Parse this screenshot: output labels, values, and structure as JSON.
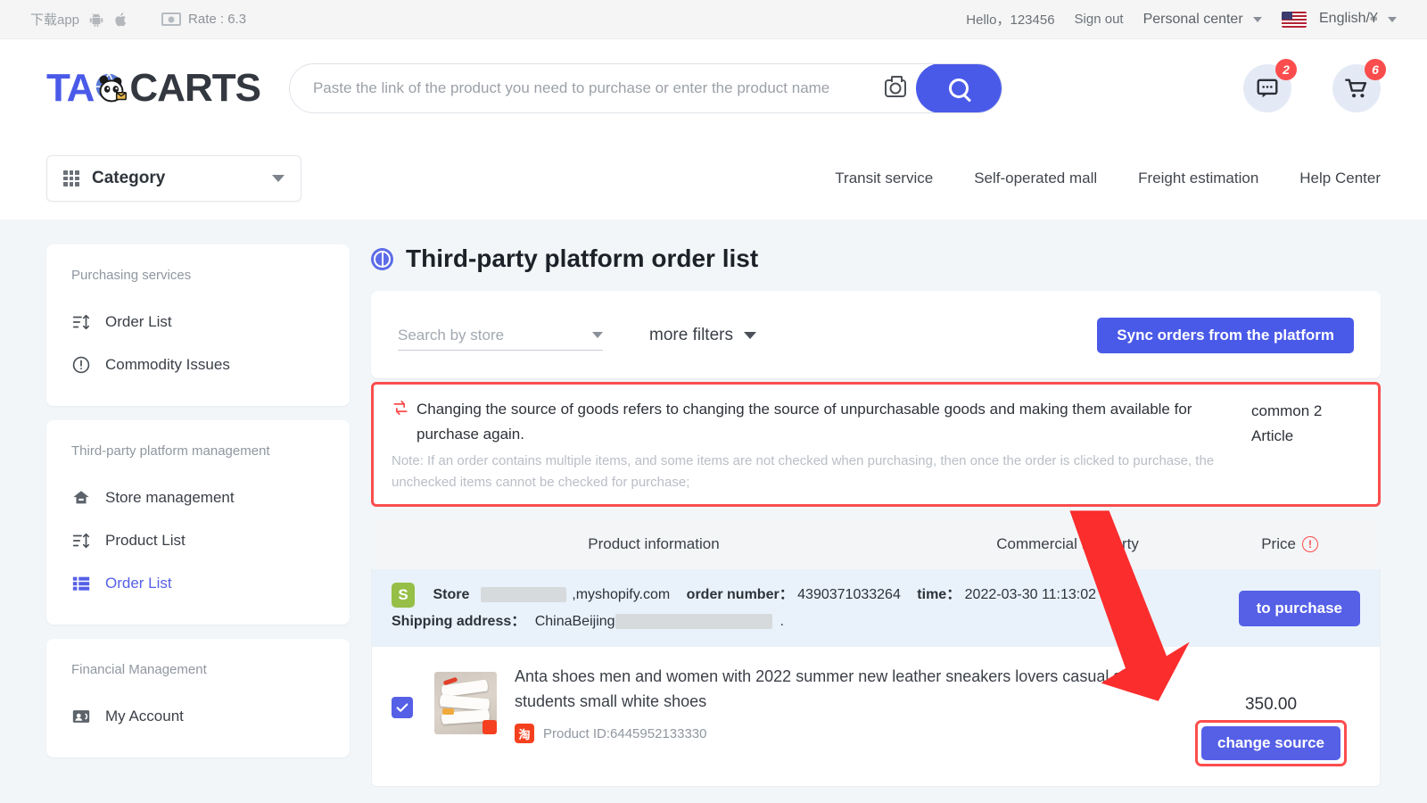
{
  "topbar": {
    "download_app": "下载app",
    "rate_label": "Rate : 6.3",
    "greeting": "Hello，123456",
    "sign_out": "Sign out",
    "personal_center": "Personal center",
    "language": "English/¥"
  },
  "header": {
    "logo_first": "TA",
    "logo_second": "CARTS",
    "search_placeholder": "Paste the link of the product you need to purchase or enter the product name",
    "search_value": "",
    "message_badge": "2",
    "cart_badge": "6"
  },
  "nav": {
    "category_label": "Category",
    "links": [
      {
        "label": "Transit service"
      },
      {
        "label": "Self-operated mall"
      },
      {
        "label": "Freight estimation"
      },
      {
        "label": "Help Center"
      }
    ]
  },
  "sidebar": {
    "groups": [
      {
        "title": "Purchasing services",
        "items": [
          {
            "label": "Order List",
            "icon": "list-sort-icon",
            "active": false
          },
          {
            "label": "Commodity Issues",
            "icon": "exclamation-circle-icon",
            "active": false
          }
        ]
      },
      {
        "title": "Third-party platform management",
        "items": [
          {
            "label": "Store management",
            "icon": "store-icon",
            "active": false
          },
          {
            "label": "Product List",
            "icon": "list-sort-icon",
            "active": false
          },
          {
            "label": "Order List",
            "icon": "list-grid-icon",
            "active": true
          }
        ]
      },
      {
        "title": "Financial Management",
        "items": [
          {
            "label": "My Account",
            "icon": "account-card-icon",
            "active": false
          }
        ]
      }
    ]
  },
  "main": {
    "page_title": "Third-party platform order list",
    "filters": {
      "store_select_text": "Search by store",
      "more_filters_label": "more filters",
      "sync_button_label": "Sync orders from the platform"
    },
    "notice": {
      "text": "Changing the source of goods refers to changing the source of unpurchasable goods and making them available for purchase again.",
      "note": "Note: If an order contains multiple items, and some items are not checked when purchasing, then once the order is clicked to purchase, the unchecked items cannot be checked for purchase;",
      "side_text": "common 2 Article",
      "border_color": "#fb4d4d"
    },
    "table": {
      "headers": {
        "product_information": "Product information",
        "commercial_property": "Commercial Property",
        "price": "Price"
      }
    },
    "orders": [
      {
        "store_label": "Store",
        "store_domain": ",myshopify.com",
        "order_number_label": "order number：",
        "order_number": "4390371033264",
        "time_label": "time：",
        "time": "2022-03-30 11:13:02",
        "shipping_label": "Shipping address：",
        "shipping_value": "ChinaBeijing",
        "shipping_suffix": ".",
        "purchase_button_label": "to purchase",
        "item": {
          "name": "Anta shoes men and women with 2022 summer new leather sneakers lovers casual shoes students small white shoes",
          "product_id": "Product ID:6445952133330",
          "price": "350.00",
          "change_source_label": "change source",
          "checked": true
        }
      }
    ]
  },
  "colors": {
    "primary_blue": "#4a5ae8",
    "button_blue": "#5560e6",
    "highlight_red": "#fb4d4d",
    "page_bg": "#f2f6f9",
    "order_head_bg": "#e9f2fb"
  }
}
